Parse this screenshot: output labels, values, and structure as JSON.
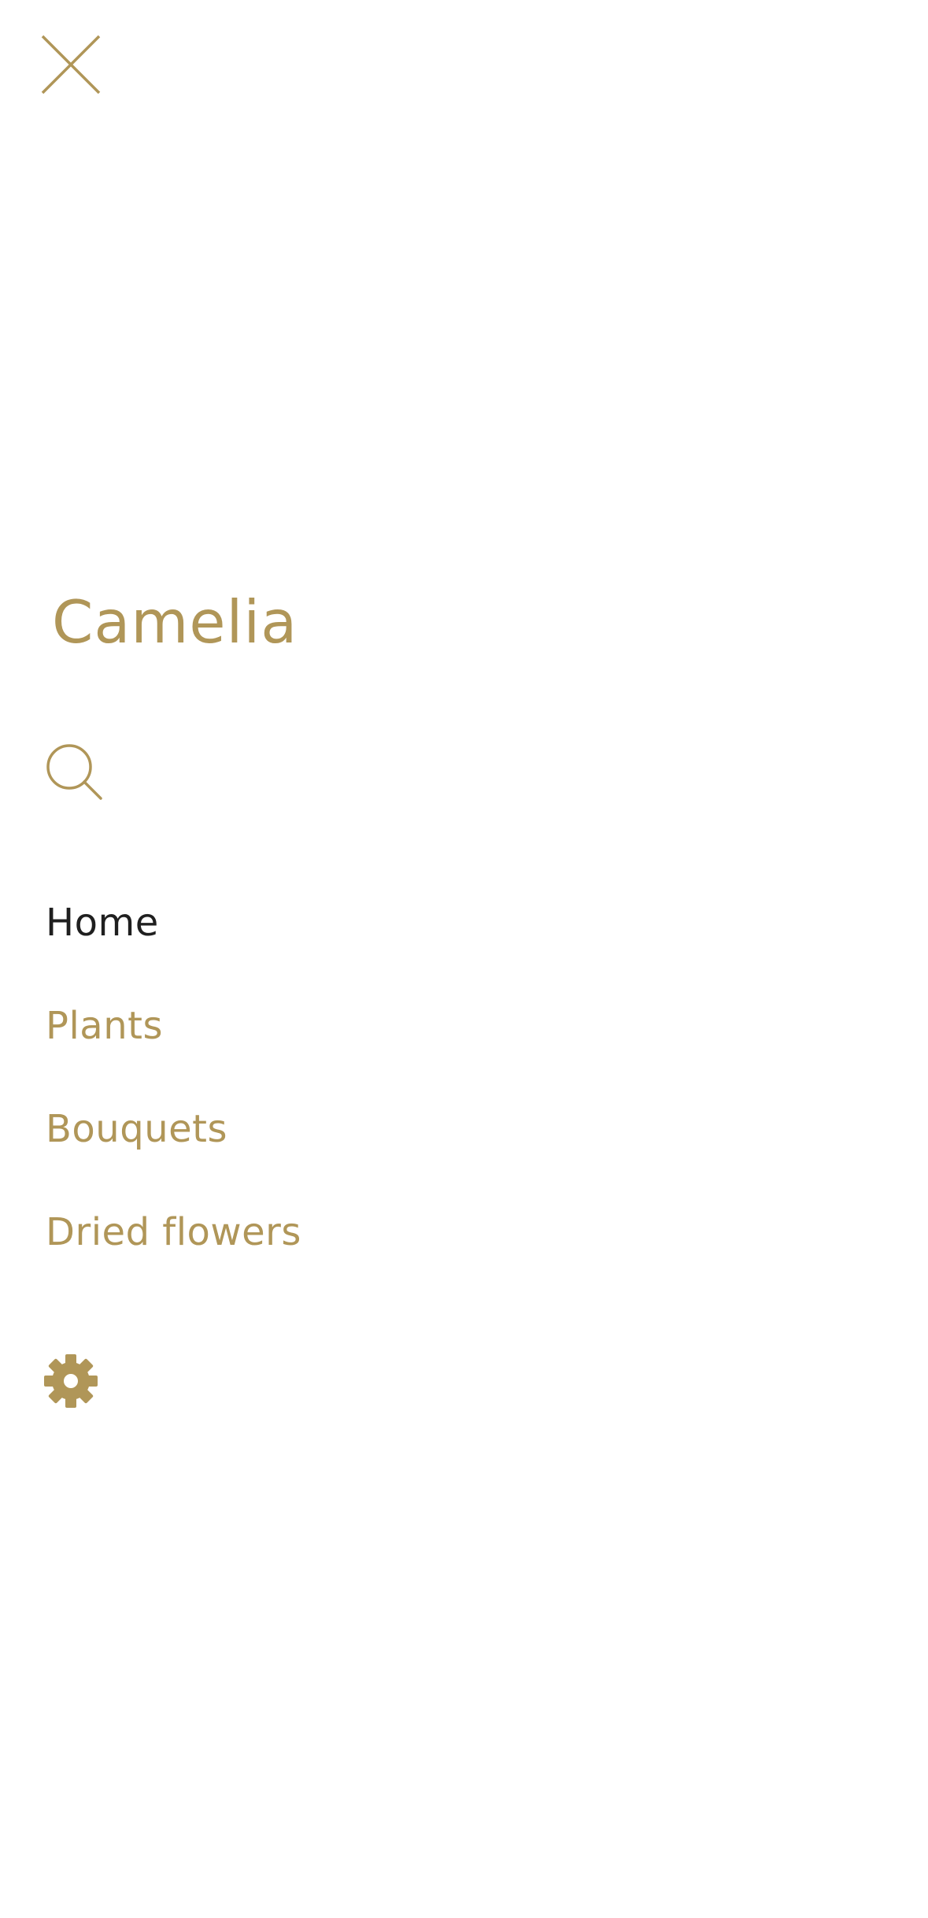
{
  "theme": {
    "accent_color": "#b09658",
    "active_color": "#1f1f1f",
    "background_color": "#ffffff"
  },
  "header": {
    "close_icon": "close-icon"
  },
  "brand": {
    "title": "Camelia"
  },
  "search": {
    "icon": "search-icon"
  },
  "nav": {
    "items": [
      {
        "label": "Home",
        "active": true
      },
      {
        "label": "Plants",
        "active": false
      },
      {
        "label": "Bouquets",
        "active": false
      },
      {
        "label": "Dried flowers",
        "active": false
      }
    ]
  },
  "footer": {
    "settings_icon": "gear-icon"
  }
}
